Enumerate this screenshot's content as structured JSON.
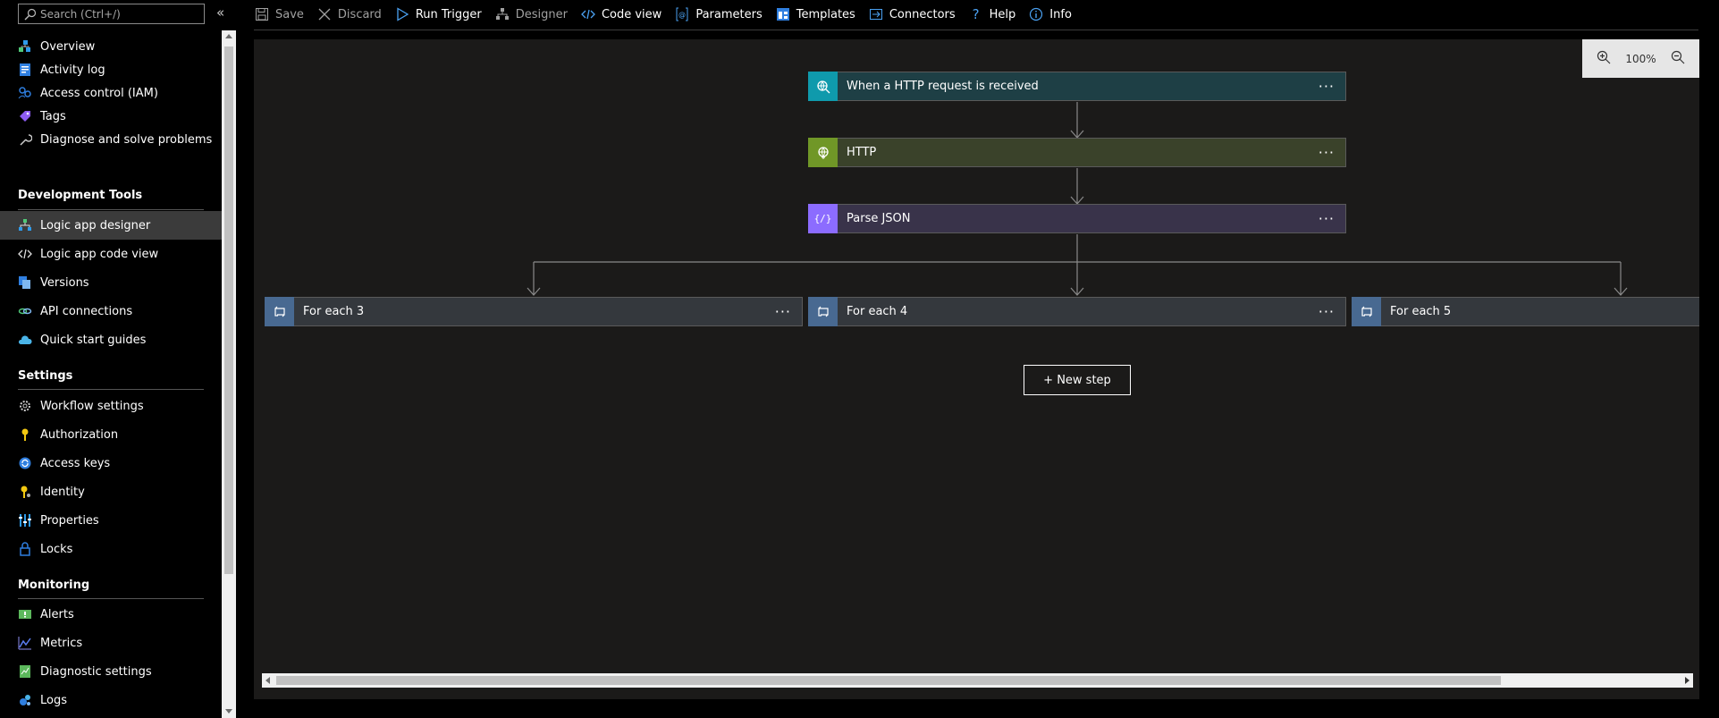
{
  "search": {
    "placeholder": "Search (Ctrl+/)"
  },
  "sidebar": {
    "top_items": [
      {
        "label": "Overview",
        "icon": "overview-icon"
      },
      {
        "label": "Activity log",
        "icon": "activity-log-icon"
      },
      {
        "label": "Access control (IAM)",
        "icon": "iam-icon"
      },
      {
        "label": "Tags",
        "icon": "tag-icon"
      },
      {
        "label": "Diagnose and solve problems",
        "icon": "wrench-icon"
      }
    ],
    "sections": [
      {
        "header": "Development Tools",
        "items": [
          {
            "label": "Logic app designer",
            "icon": "designer-icon",
            "selected": true
          },
          {
            "label": "Logic app code view",
            "icon": "code-icon"
          },
          {
            "label": "Versions",
            "icon": "versions-icon"
          },
          {
            "label": "API connections",
            "icon": "link-icon"
          },
          {
            "label": "Quick start guides",
            "icon": "cloud-icon"
          }
        ]
      },
      {
        "header": "Settings",
        "items": [
          {
            "label": "Workflow settings",
            "icon": "gear-icon"
          },
          {
            "label": "Authorization",
            "icon": "key-icon"
          },
          {
            "label": "Access keys",
            "icon": "refresh-key-icon"
          },
          {
            "label": "Identity",
            "icon": "identity-key-icon"
          },
          {
            "label": "Properties",
            "icon": "properties-icon"
          },
          {
            "label": "Locks",
            "icon": "lock-icon"
          }
        ]
      },
      {
        "header": "Monitoring",
        "items": [
          {
            "label": "Alerts",
            "icon": "alert-icon"
          },
          {
            "label": "Metrics",
            "icon": "metrics-icon"
          },
          {
            "label": "Diagnostic settings",
            "icon": "diagnostic-icon"
          },
          {
            "label": "Logs",
            "icon": "logs-icon"
          }
        ]
      }
    ]
  },
  "toolbar": {
    "save": "Save",
    "discard": "Discard",
    "run_trigger": "Run Trigger",
    "designer": "Designer",
    "code_view": "Code view",
    "parameters": "Parameters",
    "templates": "Templates",
    "connectors": "Connectors",
    "help": "Help",
    "info": "Info"
  },
  "zoom": {
    "level": "100%"
  },
  "workflow": {
    "trigger": {
      "title": "When a HTTP request is received",
      "color": "#0e7a8c",
      "badge": "#0f9aac"
    },
    "http": {
      "title": "HTTP",
      "color": "#3f4a1f",
      "badge": "#709727"
    },
    "parse_json": {
      "title": "Parse JSON",
      "color": "#3d3650",
      "badge": "#8c6cff"
    },
    "branches": [
      {
        "title": "For each 3"
      },
      {
        "title": "For each 4"
      },
      {
        "title": "For each 5"
      }
    ],
    "loop_color": "#3a3d42",
    "loop_badge": "#486991"
  },
  "new_step": {
    "label": "+ New step"
  },
  "colors": {
    "accent": "#0078d4",
    "canvas": "#1b1a19"
  }
}
